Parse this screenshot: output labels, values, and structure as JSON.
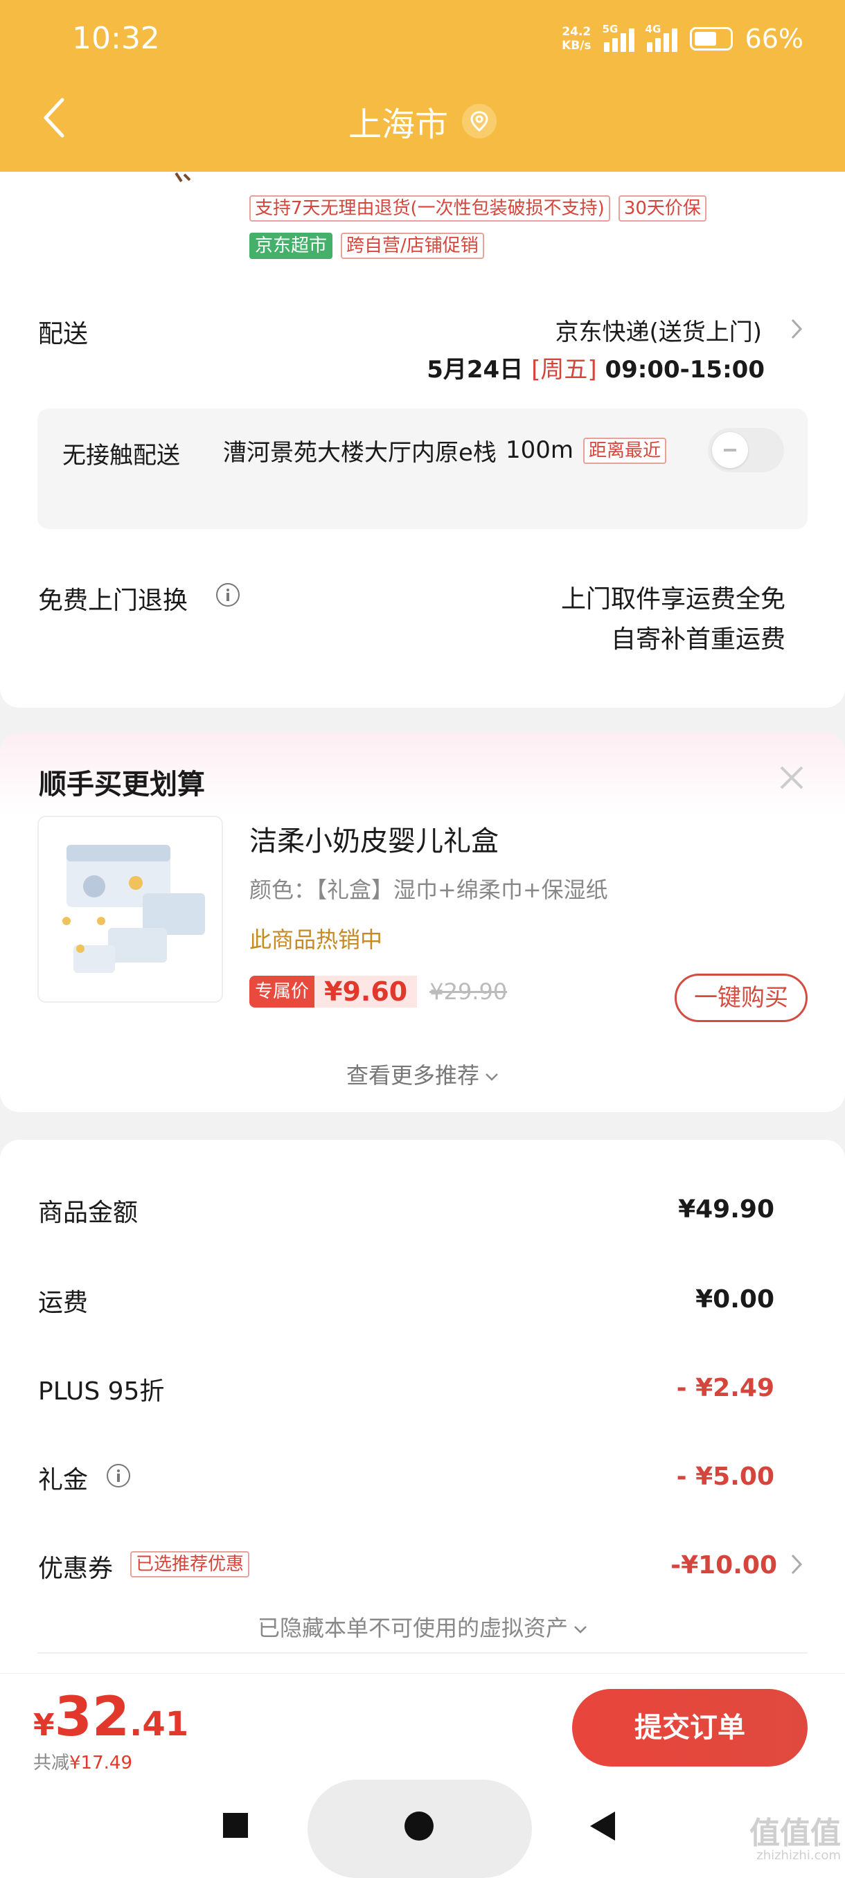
{
  "status_bar": {
    "time": "10:32",
    "net_speed_value": "24.2",
    "net_speed_unit": "KB/s",
    "sim1_label": "5G",
    "sim2_label": "4G",
    "battery": "66%"
  },
  "header": {
    "title": "上海市",
    "accent_color": "#f6bb43"
  },
  "product_tags": {
    "return_policy": "支持7天无理由退货(一次性包装破损不支持)",
    "price_protect": "30天价保",
    "store": "京东超市",
    "promo": "跨自营/店铺促销"
  },
  "delivery": {
    "label": "配送",
    "method": "京东快递(送货上门)",
    "date": "5月24日",
    "weekday": "[周五]",
    "window": "09:00-15:00"
  },
  "no_contact": {
    "label": "无接触配送",
    "address": "漕河景苑大楼大厅内原e栈",
    "distance": "100m",
    "badge": "距离最近",
    "enabled": false
  },
  "free_return": {
    "label": "免费上门退换",
    "line1": "上门取件享运费全免",
    "line2": "自寄补首重运费"
  },
  "recommend": {
    "title": "顺手买更划算",
    "product_name": "洁柔小奶皮婴儿礼盒",
    "product_spec": "颜色：【礼盒】湿巾+绵柔巾+保湿纸",
    "hot_text": "此商品热销中",
    "exclusive_tag": "专属价",
    "price": "¥9.60",
    "original_price": "¥29.90",
    "buy_button": "一键购买",
    "more": "查看更多推荐"
  },
  "summary": {
    "goods_label": "商品金额",
    "goods_value": "¥49.90",
    "shipping_label": "运费",
    "shipping_value": "¥0.00",
    "plus_label": "PLUS 95折",
    "plus_value": "- ¥2.49",
    "gift_label": "礼金",
    "gift_value": "- ¥5.00",
    "coupon_label": "优惠券",
    "coupon_badge": "已选推荐优惠",
    "coupon_value": "-¥10.00",
    "hidden_assets": "已隐藏本单不可使用的虚拟资产"
  },
  "bottom": {
    "currency": "¥",
    "total_int": "32",
    "total_dec": ".41",
    "saved_label": "共减",
    "saved_amount": "¥17.49",
    "submit": "提交订单"
  },
  "watermark": {
    "logo": "值值值",
    "site": "zhizhizhi.com"
  }
}
